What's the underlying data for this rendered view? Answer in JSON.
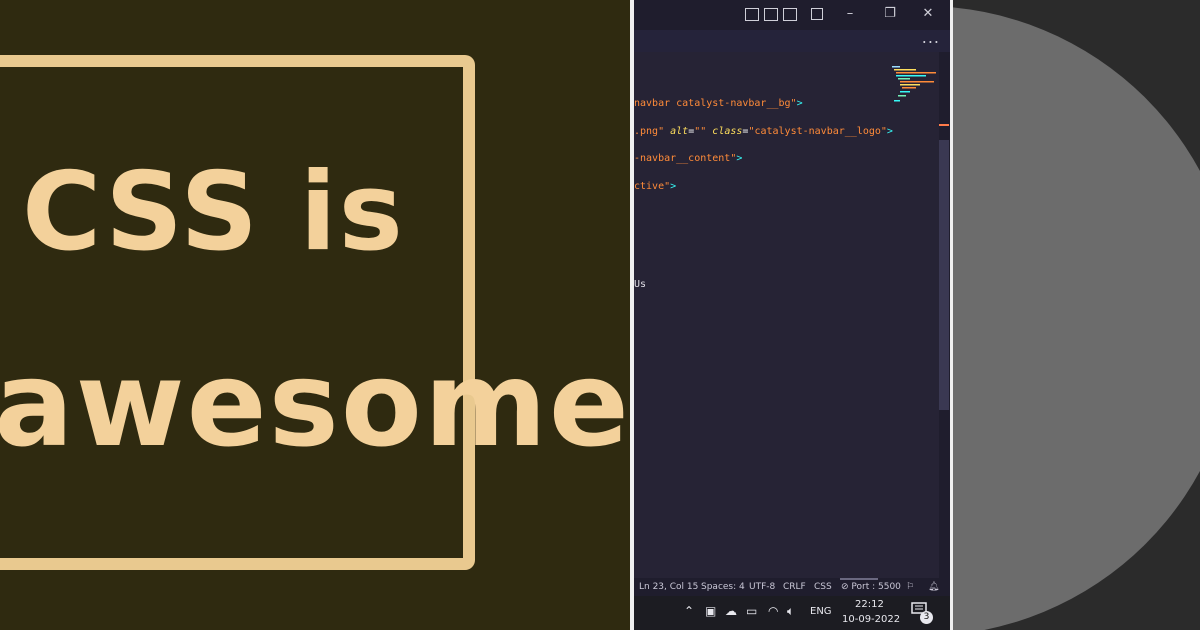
{
  "meme": {
    "line1": "CSS is",
    "line2": "awesome"
  },
  "editor": {
    "more_label": "...",
    "code_lines": [
      {
        "parts": [
          {
            "t": "navbar catalyst-navbar__bg\"",
            "c": "str"
          },
          {
            "t": ">",
            "c": "punc"
          }
        ]
      },
      {
        "parts": [
          {
            "t": ".png\"",
            "c": "str"
          },
          {
            "t": " alt",
            "c": "attr"
          },
          {
            "t": "=",
            "c": "eq"
          },
          {
            "t": "\"\"",
            "c": "str"
          },
          {
            "t": " class",
            "c": "attr"
          },
          {
            "t": "=",
            "c": "eq"
          },
          {
            "t": "\"catalyst-navbar__logo\"",
            "c": "str"
          },
          {
            "t": ">",
            "c": "punc"
          }
        ]
      },
      {
        "parts": [
          {
            "t": "-navbar__content\"",
            "c": "str"
          },
          {
            "t": ">",
            "c": "punc"
          }
        ]
      },
      {
        "parts": [
          {
            "t": "ctive\"",
            "c": "str"
          },
          {
            "t": ">",
            "c": "punc"
          }
        ]
      },
      {
        "parts": [
          {
            "t": "Us",
            "c": "plain"
          }
        ]
      }
    ],
    "status": {
      "position": "Ln 23, Col 15",
      "spaces": "Spaces: 4",
      "encoding": "UTF-8",
      "eol": "CRLF",
      "language": "CSS",
      "port": "Port : 5500"
    },
    "taskbar": {
      "language": "ENG",
      "time": "22:12",
      "date": "10-09-2022",
      "notifications": "3"
    }
  },
  "colors": {
    "meme_bg": "#2f2a10",
    "meme_text": "#f3d19b",
    "editor_bg": "#262335",
    "string": "#ff8b39",
    "attribute": "#fede5d",
    "punctuation": "#36f9f6"
  }
}
